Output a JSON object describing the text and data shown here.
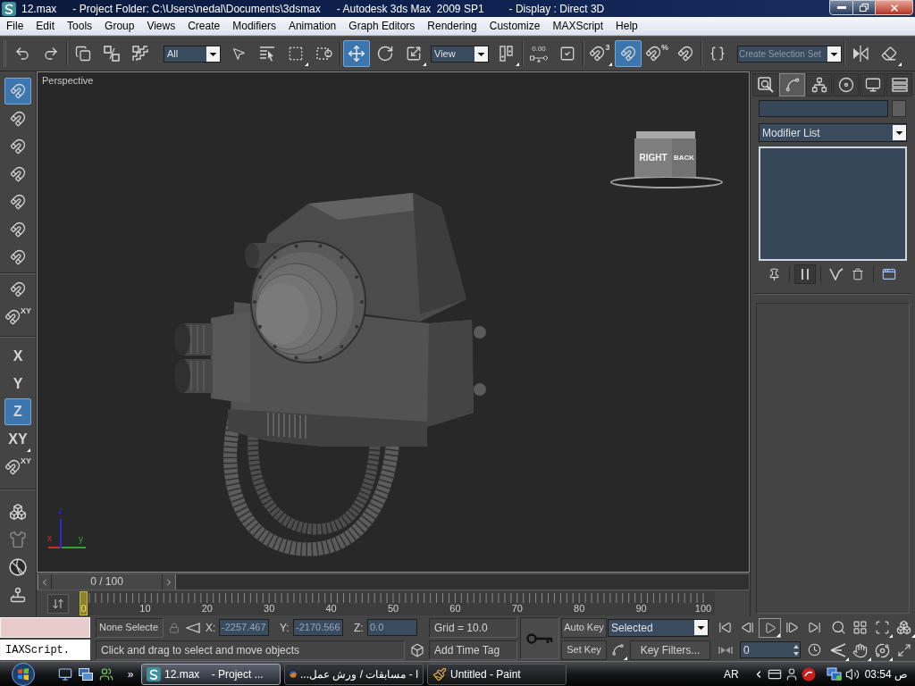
{
  "window": {
    "title_parts": [
      "12.max",
      "- Project Folder: C:\\Users\\nedal\\Documents\\3dsmax",
      "- Autodesk 3ds Max  2009 SP1",
      "- Display : Direct 3D"
    ]
  },
  "menu": [
    "File",
    "Edit",
    "Tools",
    "Group",
    "Views",
    "Create",
    "Modifiers",
    "Animation",
    "Graph Editors",
    "Rendering",
    "Customize",
    "MAXScript",
    "Help"
  ],
  "main_toolbar": {
    "groups": [
      [
        {
          "kind": "icon",
          "selected": false
        },
        {
          "kind": "icon",
          "selected": false
        }
      ],
      [
        {
          "kind": "icon",
          "selected": false
        },
        {
          "kind": "icon",
          "selected": false
        },
        {
          "kind": "icon",
          "selected": false
        },
        {
          "kind": "dropdown",
          "value": "All"
        },
        {
          "kind": "icon",
          "selected": false
        },
        {
          "kind": "icon",
          "selected": false
        },
        {
          "kind": "icon",
          "selected": false,
          "flyout": true
        },
        {
          "kind": "icon",
          "selected": false
        }
      ],
      [
        {
          "kind": "icon",
          "selected": true
        },
        {
          "kind": "icon",
          "selected": false
        },
        {
          "kind": "icon",
          "selected": false,
          "flyout": true
        },
        {
          "kind": "dropdown",
          "value": "View"
        },
        {
          "kind": "icon",
          "selected": false,
          "flyout": true
        }
      ],
      [
        {
          "kind": "icon",
          "selected": false,
          "label": "0.00"
        },
        {
          "kind": "icon",
          "selected": false
        }
      ],
      [
        {
          "kind": "icon",
          "selected": false,
          "label": "3",
          "flyout": true
        },
        {
          "kind": "icon",
          "selected": true
        },
        {
          "kind": "icon",
          "selected": false,
          "label": "%"
        },
        {
          "kind": "icon",
          "selected": false
        }
      ],
      [
        {
          "kind": "icon",
          "selected": false
        },
        {
          "kind": "combo",
          "placeholder": "Create Selection Set"
        }
      ],
      [
        {
          "kind": "icon",
          "selected": false
        },
        {
          "kind": "icon",
          "selected": false,
          "flyout": true
        }
      ]
    ]
  },
  "left_toolbar": {
    "groups": [
      [
        {
          "kind": "icon",
          "selected": true
        },
        {
          "kind": "icon",
          "selected": false
        },
        {
          "kind": "icon",
          "selected": false
        },
        {
          "kind": "icon",
          "selected": false
        },
        {
          "kind": "icon",
          "selected": false
        },
        {
          "kind": "icon",
          "selected": false
        },
        {
          "kind": "icon",
          "selected": false
        }
      ],
      [
        {
          "kind": "icon",
          "selected": false
        },
        {
          "kind": "icon",
          "selected": false,
          "label": "XY"
        }
      ],
      [
        {
          "kind": "text",
          "label": "X",
          "selected": false
        },
        {
          "kind": "text",
          "label": "Y",
          "selected": false
        },
        {
          "kind": "text",
          "label": "Z",
          "selected": true
        },
        {
          "kind": "text",
          "label": "XY",
          "selected": false,
          "flyout": true
        },
        {
          "kind": "icon",
          "selected": false,
          "label": "XY"
        }
      ],
      [
        {
          "kind": "icon",
          "selected": false
        },
        {
          "kind": "icon",
          "selected": false
        },
        {
          "kind": "icon",
          "selected": false
        },
        {
          "kind": "icon",
          "selected": false
        }
      ]
    ]
  },
  "viewport": {
    "label": "Perspective",
    "viewcube": {
      "front_face": "RIGHT",
      "side_face": "BACK"
    },
    "axes": [
      {
        "label": "x",
        "color": "#d42a2a"
      },
      {
        "label": "y",
        "color": "#2fa82f"
      },
      {
        "label": "z",
        "color": "#2a2ad4"
      }
    ]
  },
  "time_slider": {
    "label": "0 / 100",
    "level": 0
  },
  "track_bar": {
    "marker": "0",
    "labels": [
      "10",
      "20",
      "30",
      "40",
      "50",
      "60",
      "70",
      "80",
      "90",
      "100"
    ]
  },
  "command_panel": {
    "tabs": [
      {
        "selected": false
      },
      {
        "selected": true
      },
      {
        "selected": false
      },
      {
        "selected": false
      },
      {
        "selected": false
      },
      {
        "selected": false
      }
    ],
    "modifier_list": "Modifier List",
    "stack_buttons": [
      {
        "selected": false
      },
      {
        "selected": true
      },
      {
        "selected": false
      },
      {
        "selected": false
      },
      {
        "selected": false
      }
    ]
  },
  "status": {
    "maxscript_output": "IAXScript.",
    "selection": "None Selecte",
    "coordinates": [
      {
        "label": "X:",
        "value": "-2257.467"
      },
      {
        "label": "Y:",
        "value": "-2170.566"
      },
      {
        "label": "Z:",
        "value": "0.0"
      }
    ],
    "grid": "Grid = 10.0",
    "prompt": "Click and drag to select and move objects",
    "time_tag": "Add Time Tag"
  },
  "animation": {
    "auto_key": {
      "label": "Auto Key",
      "on": false
    },
    "key_mode": "Selected",
    "set_key": "Set Key",
    "key_filters": "Key Filters...",
    "frame": "0"
  },
  "taskbar": {
    "more": "»",
    "tasks": [
      {
        "label": "12.max    - Project ...",
        "selected": true
      },
      {
        "label": "ا - مسابقات / ورش عمل...",
        "selected": false
      },
      {
        "label": "Untitled - Paint",
        "selected": false
      }
    ],
    "language": "AR",
    "clock": "03:54 ص"
  }
}
